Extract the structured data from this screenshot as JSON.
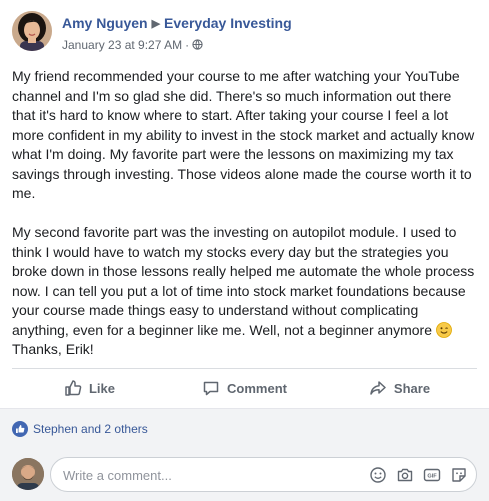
{
  "post": {
    "author": "Amy Nguyen",
    "group": "Everyday Investing",
    "arrow": "▶",
    "timestamp": "January 23 at 9:27 AM",
    "separator": "·",
    "paragraphs": [
      "My friend recommended your course to me after watching your YouTube channel and I'm so glad she did. There's so much information out there that it's hard to know where to start. After taking your course I feel a lot more confident in my ability to invest in the stock market and actually know what I'm doing. My favorite part were the lessons on maximizing my tax savings through investing. Those videos alone made the course worth it to me.",
      "My second favorite part was the investing on autopilot module. I used to think I would have to watch my stocks every day but the strategies you broke down in those lessons really helped me automate the whole process now. I can tell you put a lot of time into stock market foundations because your course made things easy to understand without complicating anything, even for a beginner like me. Well, not a beginner anymore"
    ],
    "signoff": "Thanks, Erik!"
  },
  "actions": {
    "like": "Like",
    "comment": "Comment",
    "share": "Share"
  },
  "reactions": {
    "summary": "Stephen and 2 others"
  },
  "comment_input": {
    "placeholder": "Write a comment..."
  },
  "colors": {
    "link_blue": "#385898",
    "like_blue": "#4267b2",
    "muted_text": "#606770",
    "background_gray": "#f2f3f5"
  },
  "icons": {
    "visibility": "globe-icon",
    "emoji": "smiling-face-icon",
    "like": "thumbs-up-icon",
    "comment": "speech-bubble-icon",
    "share": "share-arrow-icon",
    "tools": [
      "emoji-icon",
      "camera-icon",
      "gif-icon",
      "sticker-icon"
    ]
  }
}
